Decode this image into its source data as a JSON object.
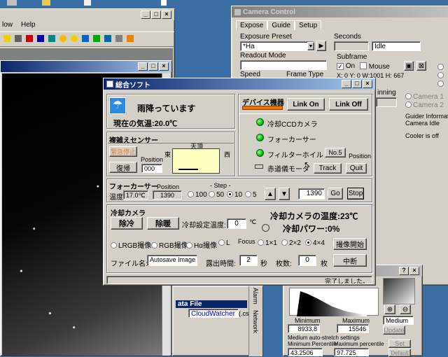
{
  "left_window": {
    "menu_low": "low",
    "menu_help": "Help"
  },
  "camera_control": {
    "title": "Camera Control",
    "tabs": [
      "Expose",
      "Guide",
      "Setup"
    ],
    "exposure_preset_label": "Exposure Preset",
    "exposure_preset_value": "*Ha",
    "seconds_label": "Seconds",
    "idle_value": "Idle",
    "readout_mode_label": "Readout Mode",
    "subframe_label": "Subframe",
    "on_label": "On",
    "mouse_label": "Mouse",
    "subframe_coords": "X: 0  Y: 0  W:1001  H: 667",
    "speed_label": "Speed",
    "frame_type_label": "Frame Type",
    "inning_label": "inning",
    "camera1_label": "Camera 1",
    "camera2_label": "Camera 2",
    "guider_info_label": "Guider Information",
    "camera_idle": "Camera Idle",
    "cooler_off": "Cooler is off"
  },
  "histogram": {
    "minimum_label": "Minimum",
    "maximum_label": "Maximum",
    "min_value": "8933.8",
    "max_value": "15546",
    "medium_label": "Medium",
    "update_label": "Update",
    "auto_stretch": "Medium auto-stretch settings",
    "min_pct_label": "Minimum Percentile",
    "max_pct_label": "Maximum percentile",
    "min_pct": "43.2506",
    "max_pct": "97.725",
    "set_label": "Set",
    "default_label": "Default"
  },
  "bottom_panel": {
    "data_file_label": "ata File",
    "cloudwatcher_label": "CloudWatcher",
    "csv_label": "(.csv)",
    "tab_alarm": "Alarm",
    "tab_network": "Network"
  },
  "main": {
    "title": "総合ソフト",
    "weather_text": "雨降っています",
    "temp_text": "現在の気温:20.0℃",
    "device_label": "デバイス機器",
    "link_on": "Link On",
    "link_off": "Link Off",
    "ccd_camera": "冷却CCDカメラ",
    "focuser": "フォーカーサー",
    "filter_wheel": "フィルターホイル",
    "filter_pos": "No.5",
    "position_label": "Position",
    "equatorial": "赤道儀モータ",
    "track": "Track",
    "quit": "Quit",
    "rain_sensor_label": "複雑えセンサー",
    "emergency_stop": "緊急停止",
    "restore": "復帰",
    "position_value": "000",
    "sky_zenith": "天頂",
    "sky_east": "東",
    "sky_west": "西",
    "focuser_section_label": "フォーカーサー",
    "focuser_position_label": "Position",
    "step_label": "- Step -",
    "temperature_label": "温度",
    "temperature_value": "17.0℃",
    "focuser_position": "1390",
    "step_options": [
      "100",
      "50",
      "10",
      "5"
    ],
    "step_selected": "10",
    "goto_value": "1390",
    "go": "Go",
    "stop": "Stop",
    "cooling_section_label": "冷却カメラ",
    "cool_button": "除冷",
    "warm_button": "除暖",
    "set_temp_label": "冷却設定温度:",
    "set_temp_value": "0",
    "celsius": "℃",
    "camera_temp": "冷却カメラの温度:23℃",
    "cooling_power": "冷却パワー:0%",
    "filters": [
      "LRGB撮像",
      "RGB撮像",
      "Hα撮像",
      "L"
    ],
    "focus_label": "Focus",
    "binning": [
      "1×1",
      "2×2",
      "4×4"
    ],
    "binning_selected": "4×4",
    "start_capture": "撮像開始",
    "filename_label": "ファイル名:",
    "filename_value": "Autosave Image",
    "exposure_label": "露出時間:",
    "exposure_value": "2",
    "seconds_unit": "秒",
    "frames_label": "枚数:",
    "frames_value": "0",
    "frames_unit": "枚",
    "abort": "中断",
    "status": "完了しました。"
  }
}
